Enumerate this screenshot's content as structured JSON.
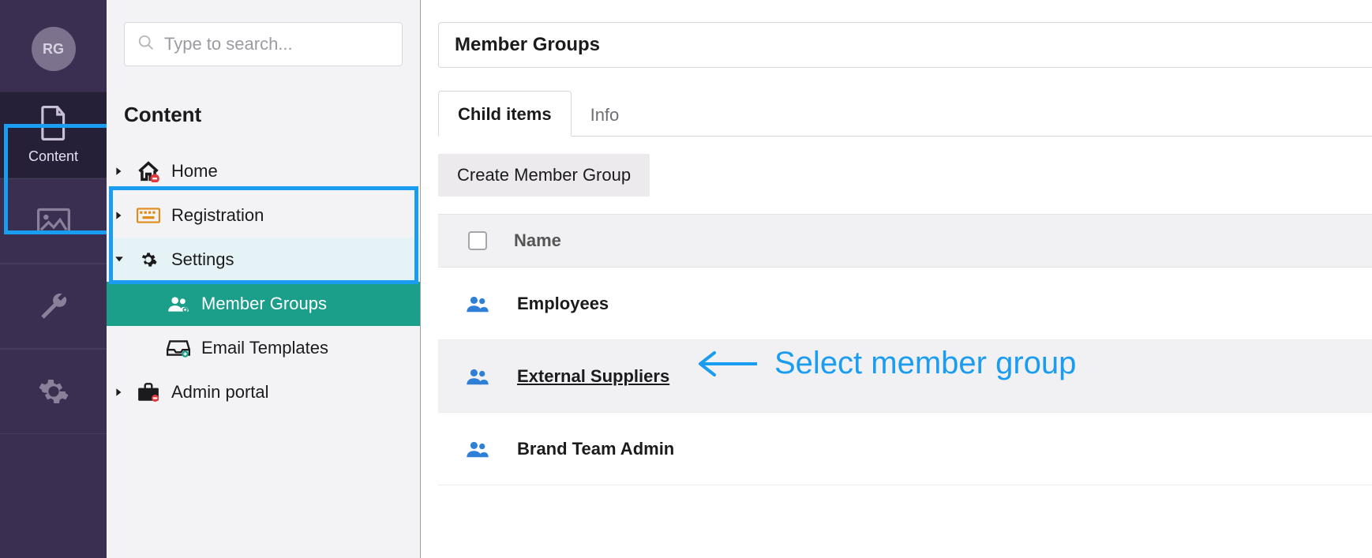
{
  "rail": {
    "avatar_initials": "RG",
    "items": [
      {
        "id": "content-section",
        "label": "Content",
        "active": true
      },
      {
        "id": "media-section",
        "label": ""
      },
      {
        "id": "tools-section",
        "label": ""
      },
      {
        "id": "settings-section",
        "label": ""
      }
    ]
  },
  "search": {
    "placeholder": "Type to search..."
  },
  "tree": {
    "title": "Content",
    "nodes": {
      "home": "Home",
      "registration": "Registration",
      "settings": "Settings",
      "member_groups": "Member Groups",
      "email_templates": "Email Templates",
      "admin_portal": "Admin portal"
    }
  },
  "main": {
    "title": "Member Groups",
    "tabs": [
      {
        "id": "child",
        "label": "Child items",
        "active": true
      },
      {
        "id": "info",
        "label": "Info",
        "active": false
      }
    ],
    "create_button": "Create Member Group",
    "column_name": "Name",
    "rows": [
      {
        "name": "Employees"
      },
      {
        "name": "External Suppliers"
      },
      {
        "name": "Brand Team Admin"
      }
    ]
  },
  "annotation": {
    "text": "Select member group"
  },
  "colors": {
    "accent_blue": "#1a9cf0",
    "active_teal": "#1b9e8a",
    "rail_bg": "#3a2e51"
  }
}
